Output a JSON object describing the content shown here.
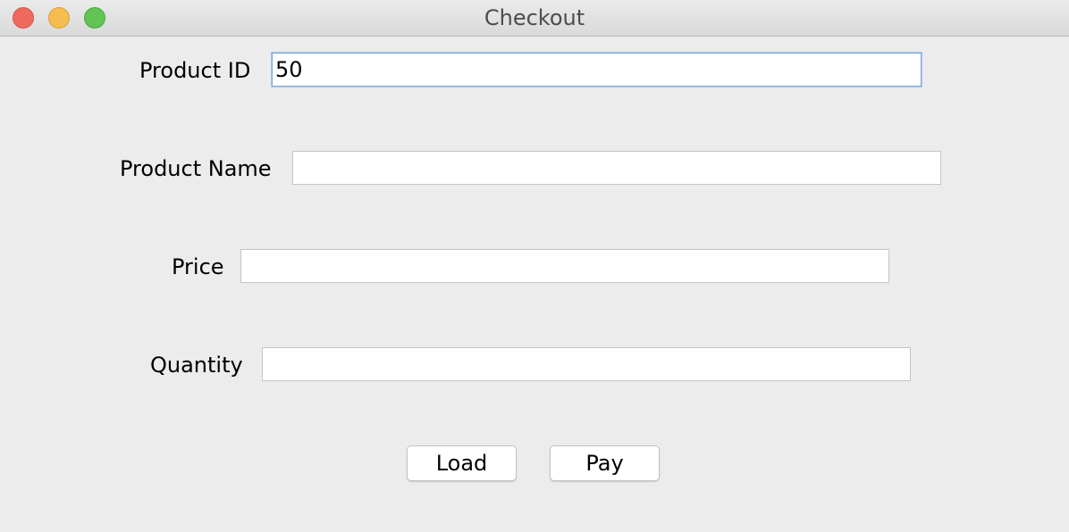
{
  "window": {
    "title": "Checkout"
  },
  "form": {
    "product_id": {
      "label": "Product ID",
      "value": "50"
    },
    "product_name": {
      "label": "Product Name",
      "value": ""
    },
    "price": {
      "label": "Price",
      "value": ""
    },
    "quantity": {
      "label": "Quantity",
      "value": ""
    }
  },
  "buttons": {
    "load_label": "Load",
    "pay_label": "Pay"
  },
  "colors": {
    "close": "#ee6a5f",
    "minimize": "#f5bd4f",
    "maximize": "#61c454",
    "focus_ring": "#7fa8dc"
  }
}
